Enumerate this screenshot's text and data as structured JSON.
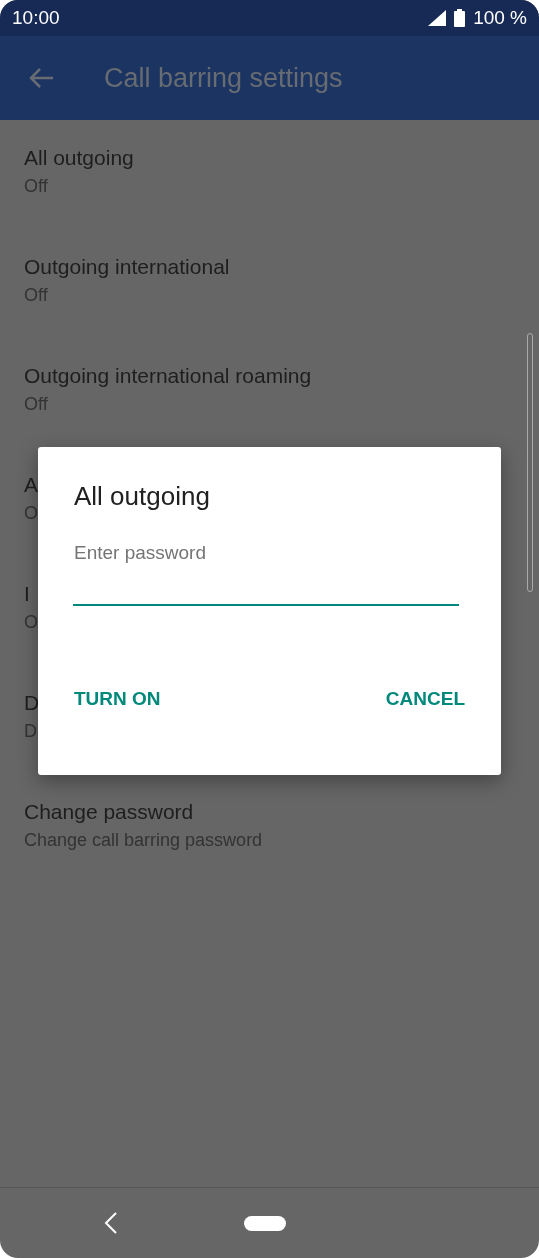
{
  "status_bar": {
    "time": "10:00",
    "battery": "100 %"
  },
  "app_bar": {
    "title": "Call barring settings"
  },
  "items": [
    {
      "title": "All outgoing",
      "subtitle": "Off"
    },
    {
      "title": "Outgoing international",
      "subtitle": "Off"
    },
    {
      "title": "Outgoing international roaming",
      "subtitle": "Off"
    },
    {
      "title": "A",
      "subtitle": "O"
    },
    {
      "title": "I",
      "subtitle": "O"
    },
    {
      "title": "D",
      "subtitle": "D"
    },
    {
      "title": "Change password",
      "subtitle": "Change call barring password"
    }
  ],
  "dialog": {
    "title": "All outgoing",
    "field": {
      "placeholder": "Enter password"
    },
    "buttons": [
      "TURN ON",
      "CANCEL"
    ]
  }
}
